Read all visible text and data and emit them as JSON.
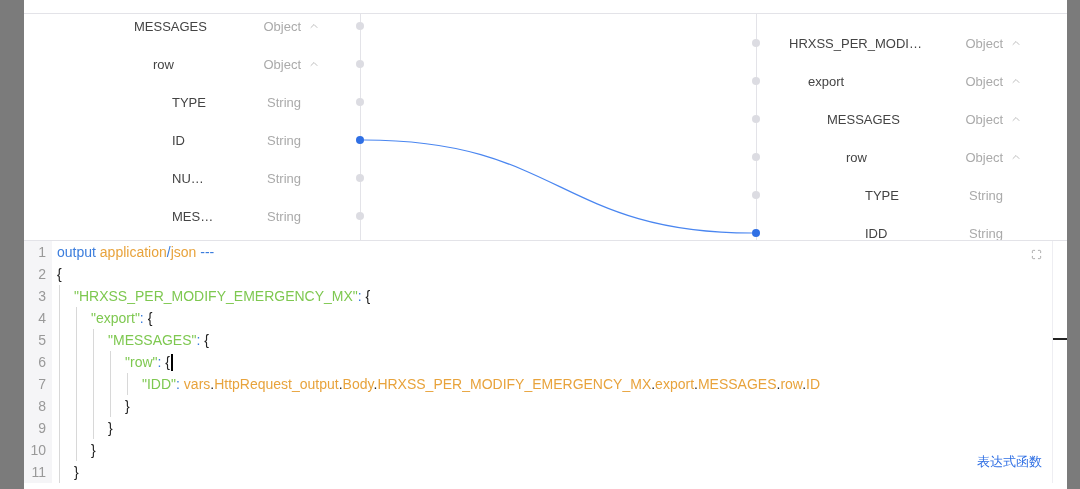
{
  "source_tree": [
    {
      "name": "MESSAGES",
      "type": "Object",
      "expanded": true,
      "linked": false,
      "children": [
        {
          "name": "row",
          "type": "Object",
          "expanded": true,
          "linked": false,
          "children": [
            {
              "name": "TYPE",
              "type": "String",
              "linked": false
            },
            {
              "name": "ID",
              "type": "String",
              "linked": true
            },
            {
              "name": "NU…",
              "type": "String",
              "linked": false
            },
            {
              "name": "MES…",
              "type": "String",
              "linked": false
            }
          ]
        }
      ]
    }
  ],
  "target_tree": [
    {
      "name": "HRXSS_PER_MODI…",
      "type": "Object",
      "expanded": true,
      "linked": false,
      "children": [
        {
          "name": "export",
          "type": "Object",
          "expanded": true,
          "linked": false,
          "children": [
            {
              "name": "MESSAGES",
              "type": "Object",
              "expanded": true,
              "linked": false,
              "children": [
                {
                  "name": "row",
                  "type": "Object",
                  "expanded": true,
                  "linked": false,
                  "children": [
                    {
                      "name": "TYPE",
                      "type": "String",
                      "linked": false
                    },
                    {
                      "name": "IDD",
                      "type": "String",
                      "linked": true
                    }
                  ]
                }
              ]
            }
          ]
        }
      ]
    }
  ],
  "editor": {
    "lines": [
      {
        "number": "1",
        "cursor": false,
        "tokens": [
          {
            "kind": "keyword",
            "text": "output "
          },
          {
            "kind": "path",
            "text": "application"
          },
          {
            "kind": "keyword",
            "text": "/"
          },
          {
            "kind": "path",
            "text": "json "
          },
          {
            "kind": "keyword",
            "text": "---"
          }
        ]
      },
      {
        "number": "2",
        "cursor": false,
        "tokens": [
          {
            "kind": "punct",
            "text": "{"
          }
        ]
      },
      {
        "number": "3",
        "cursor": false,
        "tokens": [
          {
            "kind": "string",
            "text": "  \"HRXSS_PER_MODIFY_EMERGENCY_MX\""
          },
          {
            "kind": "keyword",
            "text": ": "
          },
          {
            "kind": "punct",
            "text": "{"
          }
        ]
      },
      {
        "number": "4",
        "cursor": false,
        "tokens": [
          {
            "kind": "string",
            "text": "    \"export\""
          },
          {
            "kind": "keyword",
            "text": ": "
          },
          {
            "kind": "punct",
            "text": "{"
          }
        ]
      },
      {
        "number": "5",
        "cursor": false,
        "tokens": [
          {
            "kind": "string",
            "text": "      \"MESSAGES\""
          },
          {
            "kind": "keyword",
            "text": ": "
          },
          {
            "kind": "punct",
            "text": "{"
          }
        ]
      },
      {
        "number": "6",
        "cursor": true,
        "tokens": [
          {
            "kind": "string",
            "text": "        \"row\""
          },
          {
            "kind": "keyword",
            "text": ": "
          },
          {
            "kind": "punct",
            "text": "{"
          }
        ]
      },
      {
        "number": "7",
        "cursor": false,
        "tokens": [
          {
            "kind": "string",
            "text": "          \"IDD\""
          },
          {
            "kind": "keyword",
            "text": ": "
          },
          {
            "kind": "path",
            "text": "vars"
          },
          {
            "kind": "punct",
            "text": "."
          },
          {
            "kind": "path",
            "text": "HttpRequest_output"
          },
          {
            "kind": "punct",
            "text": "."
          },
          {
            "kind": "path",
            "text": "Body"
          },
          {
            "kind": "punct",
            "text": "."
          },
          {
            "kind": "path",
            "text": "HRXSS_PER_MODIFY_EMERGENCY_MX"
          },
          {
            "kind": "punct",
            "text": "."
          },
          {
            "kind": "path",
            "text": "export"
          },
          {
            "kind": "punct",
            "text": "."
          },
          {
            "kind": "path",
            "text": "MESSAGES"
          },
          {
            "kind": "punct",
            "text": "."
          },
          {
            "kind": "path",
            "text": "row"
          },
          {
            "kind": "punct",
            "text": "."
          },
          {
            "kind": "path",
            "text": "ID"
          }
        ]
      },
      {
        "number": "8",
        "cursor": false,
        "tokens": [
          {
            "kind": "punct",
            "text": "        }"
          }
        ]
      },
      {
        "number": "9",
        "cursor": false,
        "tokens": [
          {
            "kind": "punct",
            "text": "      }"
          }
        ]
      },
      {
        "number": "10",
        "cursor": false,
        "tokens": [
          {
            "kind": "punct",
            "text": "    }"
          }
        ]
      },
      {
        "number": "11",
        "cursor": false,
        "tokens": [
          {
            "kind": "punct",
            "text": "  }"
          }
        ]
      }
    ],
    "link": "表达式函数"
  }
}
